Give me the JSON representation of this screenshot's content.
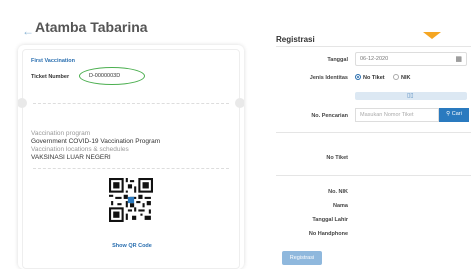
{
  "ticket": {
    "back_icon": "back-arrow-icon",
    "name": "Atamba Tabarina",
    "section_title": "First Vaccination",
    "ticket_number_label": "Ticket Number",
    "ticket_number_value": "D-0000003D",
    "program_label": "Vaccination program",
    "program_value": "Government COVID-19 Vaccination Program",
    "location_label": "Vaccination locations & schedules",
    "location_value": "VAKSINASI LUAR NEGERI",
    "qr_link": "Show QR Code"
  },
  "registration": {
    "title": "Registrasi",
    "date_label": "Tanggal",
    "date_value": "06-12-2020",
    "identity_label": "Jenis Identitas",
    "identity_options": [
      "No Tiket",
      "NIK"
    ],
    "identity_selected": "No Tiket",
    "search_label": "No. Pencarian",
    "search_placeholder": "Masukan Nomor Tiket",
    "search_button": "Cari",
    "ticket_label": "No Tiket",
    "nik_label": "No. NIK",
    "name_label": "Nama",
    "dob_label": "Tanggal Lahir",
    "phone_label": "No Handphone",
    "submit_button": "Registrasi"
  }
}
